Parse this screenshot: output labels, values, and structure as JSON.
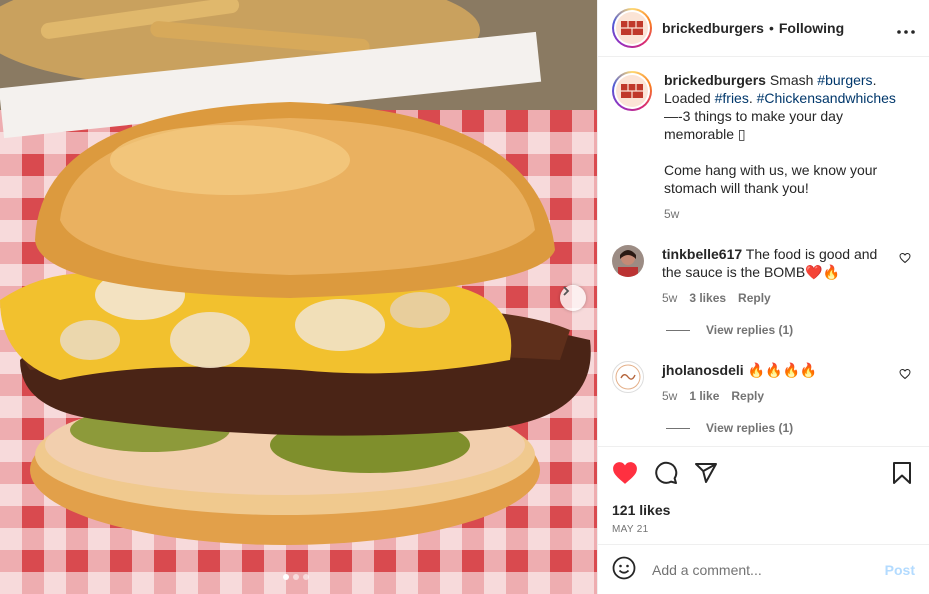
{
  "post": {
    "username": "brickedburgers",
    "separator": "•",
    "follow_status": "Following",
    "more": "•••"
  },
  "caption": {
    "username": "brickedburgers",
    "text_1": " Smash ",
    "tag_1": "#burgers",
    "text_2": ". Loaded ",
    "tag_2": "#fries",
    "text_3": ". ",
    "tag_3": "#Chickensandwhiches",
    "text_4": " —-3 things to make your day memorable ▯",
    "text_5": "Come hang with us, we know your stomach will thank you!",
    "time": "5w"
  },
  "comments": [
    {
      "username": "tinkbelle617",
      "text": " The food is good and the sauce is the BOMB❤️🔥",
      "time": "5w",
      "likes": "3 likes",
      "reply": "Reply",
      "view_replies": "View replies (1)"
    },
    {
      "username": "jholanosdeli",
      "text": " 🔥🔥🔥🔥",
      "time": "5w",
      "likes": "1 like",
      "reply": "Reply",
      "view_replies": "View replies (1)"
    }
  ],
  "engagement": {
    "likes": "121 likes",
    "date": "MAY 21",
    "liked": true
  },
  "composer": {
    "placeholder": "Add a comment...",
    "post_label": "Post"
  },
  "carousel": {
    "slide_count": 3,
    "active_index": 0
  },
  "colors": {
    "like_red": "#ff3040",
    "link_blue": "#00376b",
    "post_disabled": "#b3dbff",
    "brand_brick": "#c0392b"
  }
}
